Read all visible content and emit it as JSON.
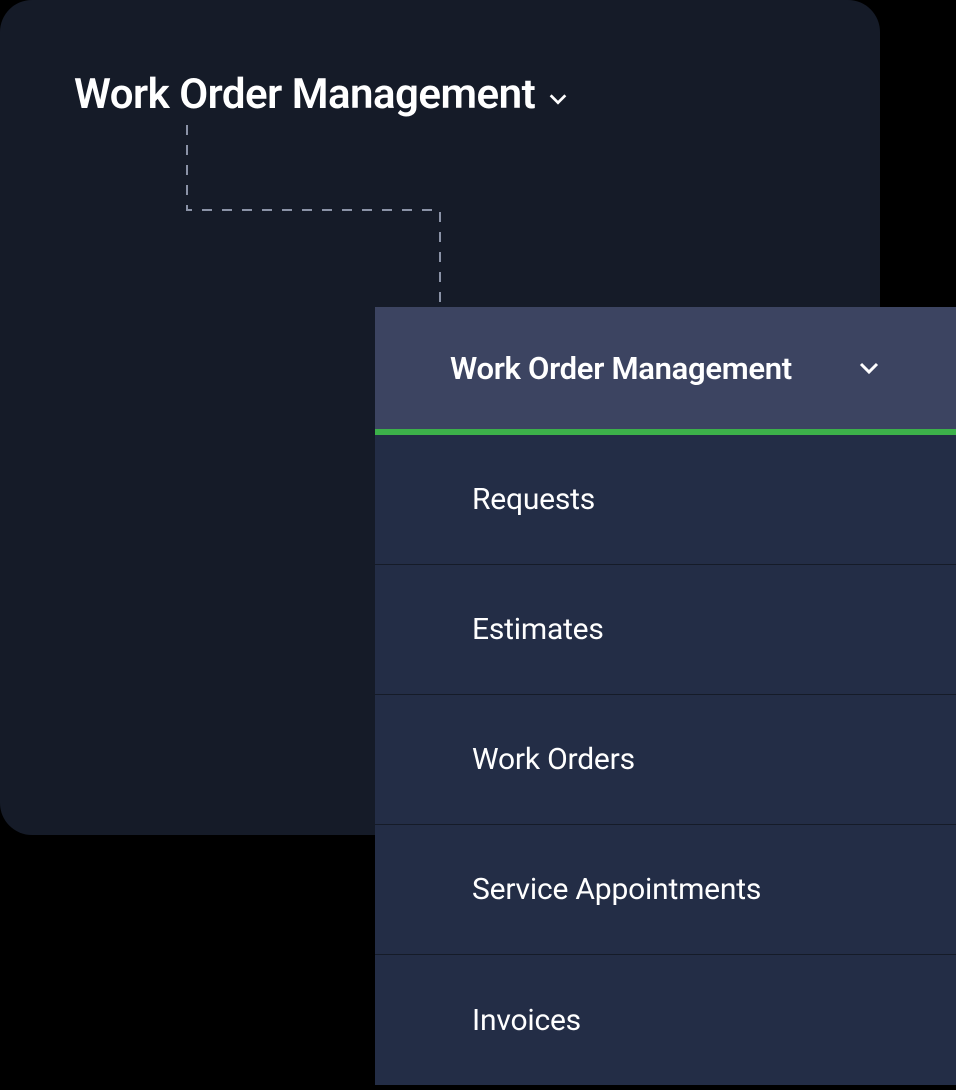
{
  "page": {
    "title": "Work Order Management"
  },
  "dropdown": {
    "header_label": "Work Order Management",
    "accent_color": "#3cb14a",
    "items": [
      {
        "label": "Requests"
      },
      {
        "label": "Estimates"
      },
      {
        "label": "Work Orders"
      },
      {
        "label": "Service Appointments"
      },
      {
        "label": "Invoices"
      }
    ]
  }
}
